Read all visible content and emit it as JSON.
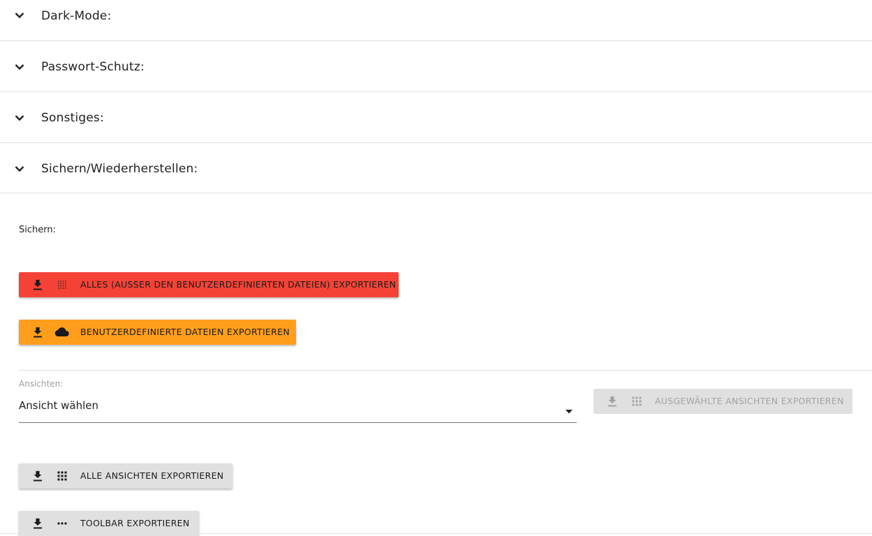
{
  "sections": [
    {
      "title": "Dark-Mode:",
      "icon": "chevron-down-icon"
    },
    {
      "title": "Passwort-Schutz:",
      "icon": "chevron-down-icon"
    },
    {
      "title": "Sonstiges:",
      "icon": "chevron-down-icon"
    },
    {
      "title": "Sichern/Wiederherstellen:",
      "icon": "chevron-down-icon"
    }
  ],
  "backup": {
    "heading": "Sichern:",
    "export_all_label": "ALLES (AUSSER DEN BENUTZERDEFINIERTEN DATEIEN) EXPORTIEREN",
    "export_custom_label": "BENUTZERDEFINIERTE DATEIEN EXPORTIEREN",
    "views_label": "Ansichten:",
    "views_select_value": "Ansicht wählen",
    "export_selected_label": "AUSGEWÄHLTE ANSICHTEN EXPORTIEREN",
    "export_all_views_label": "ALLE ANSICHTEN EXPORTIEREN",
    "export_toolbar_label": "TOOLBAR EXPORTIEREN"
  },
  "colors": {
    "red_button": "#f44336",
    "orange_button": "#ff9e1b",
    "grey_button": "#e0e0e0",
    "disabled_text": "#a3a3a3"
  },
  "icons": {
    "download": "download-icon",
    "dots_grid": "dot-matrix-icon",
    "cloud": "cloud-icon",
    "apps_grid": "apps-grid-icon",
    "more": "more-horiz-icon",
    "dropdown": "arrow-drop-down-icon"
  }
}
